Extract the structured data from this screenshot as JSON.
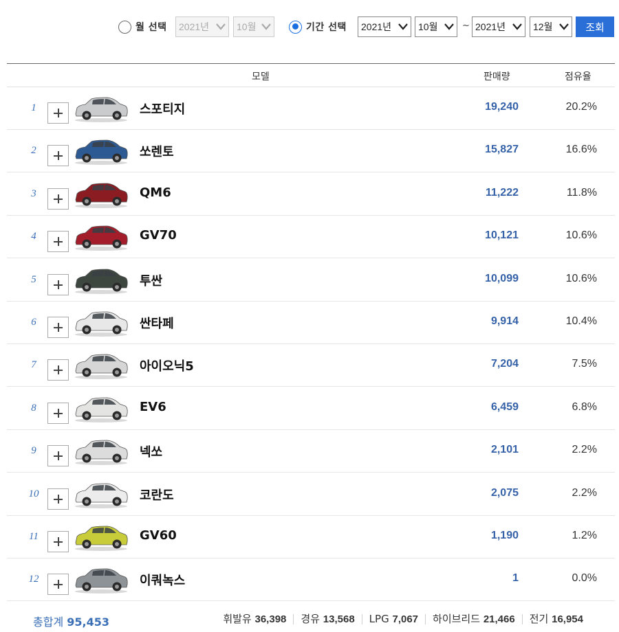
{
  "filter": {
    "month_radio_label": "월 선택",
    "month_year": "2021년",
    "month_month": "10월",
    "period_radio_label": "기간 선택",
    "start_year": "2021년",
    "start_month": "10월",
    "separator": "~",
    "end_year": "2021년",
    "end_month": "12월",
    "search_button": "조회",
    "selected_mode": "period"
  },
  "table": {
    "headers": {
      "model": "모델",
      "sales": "판매량",
      "share": "점유율"
    },
    "rows": [
      {
        "rank": "1",
        "model": "스포티지",
        "sales": "19,240",
        "share": "20.2%",
        "car_icon": "silver-suv-icon"
      },
      {
        "rank": "2",
        "model": "쏘렌토",
        "sales": "15,827",
        "share": "16.6%",
        "car_icon": "blue-suv-icon"
      },
      {
        "rank": "3",
        "model": "QM6",
        "sales": "11,222",
        "share": "11.8%",
        "car_icon": "red-suv-icon"
      },
      {
        "rank": "4",
        "model": "GV70",
        "sales": "10,121",
        "share": "10.6%",
        "car_icon": "red-suv-icon"
      },
      {
        "rank": "5",
        "model": "투싼",
        "sales": "10,099",
        "share": "10.6%",
        "car_icon": "dark-green-suv-icon"
      },
      {
        "rank": "6",
        "model": "싼타페",
        "sales": "9,914",
        "share": "10.4%",
        "car_icon": "white-suv-icon"
      },
      {
        "rank": "7",
        "model": "아이오닉5",
        "sales": "7,204",
        "share": "7.5%",
        "car_icon": "silver-suv-icon"
      },
      {
        "rank": "8",
        "model": "EV6",
        "sales": "6,459",
        "share": "6.8%",
        "car_icon": "white-suv-icon"
      },
      {
        "rank": "9",
        "model": "넥쏘",
        "sales": "2,101",
        "share": "2.2%",
        "car_icon": "white-suv-icon"
      },
      {
        "rank": "10",
        "model": "코란도",
        "sales": "2,075",
        "share": "2.2%",
        "car_icon": "white-suv-icon"
      },
      {
        "rank": "11",
        "model": "GV60",
        "sales": "1,190",
        "share": "1.2%",
        "car_icon": "yellow-suv-icon"
      },
      {
        "rank": "12",
        "model": "이쿼녹스",
        "sales": "1",
        "share": "0.0%",
        "car_icon": "grey-suv-icon"
      }
    ]
  },
  "footer": {
    "total_label": "총합계",
    "total_value": "95,453",
    "breakdown": [
      {
        "label": "휘발유",
        "value": "36,398"
      },
      {
        "label": "경유",
        "value": "13,568"
      },
      {
        "label": "LPG",
        "value": "7,067"
      },
      {
        "label": "하이브리드",
        "value": "21,466"
      },
      {
        "label": "전기",
        "value": "16,954"
      }
    ]
  },
  "colors": {
    "accent": "#2a6fd8",
    "rank_and_total": "#3a6fb8",
    "sales_value": "#3561a8",
    "car_colors": [
      "#c9cbcd",
      "#2d5a93",
      "#8a1c22",
      "#a31d2b",
      "#3e4640",
      "#e8e8e8",
      "#d6d6d6",
      "#e4e4e2",
      "#dcdcdc",
      "#ececec",
      "#c8cc3a",
      "#8e9397"
    ]
  }
}
